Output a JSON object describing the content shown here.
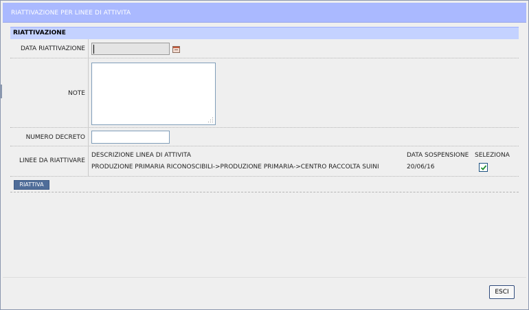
{
  "dialog": {
    "title": "RIATTIVAZIONE PER LINEE DI ATTIVITA"
  },
  "section": {
    "header": "RIATTIVAZIONE"
  },
  "form": {
    "data_label": "DATA RIATTIVAZIONE",
    "data_value": "",
    "note_label": "NOTE",
    "note_value": "",
    "decreto_label": "NUMERO DECRETO",
    "decreto_value": "",
    "linee_label": "LINEE DA RIATTIVARE"
  },
  "linee": {
    "columns": [
      "DESCRIZIONE LINEA DI ATTIVITA",
      "DATA SOSPENSIONE",
      "SELEZIONA"
    ],
    "rows": [
      {
        "descrizione": "PRODUZIONE PRIMARIA RICONOSCIBILI->PRODUZIONE PRIMARIA->CENTRO RACCOLTA SUINI",
        "data_sospensione": "20/06/16",
        "selezionato": true
      }
    ]
  },
  "buttons": {
    "riattiva": "RIATTIVA",
    "esci": "ESCI"
  },
  "icons": {
    "calendar": "calendar-icon",
    "check": "checkmark-icon",
    "resize": "resize-grip-icon"
  },
  "colors": {
    "titlebar": "#aab9ff",
    "section_header": "#c4d2ff",
    "primary_button": "#4f6d99",
    "dialog_bg": "#efefef"
  }
}
